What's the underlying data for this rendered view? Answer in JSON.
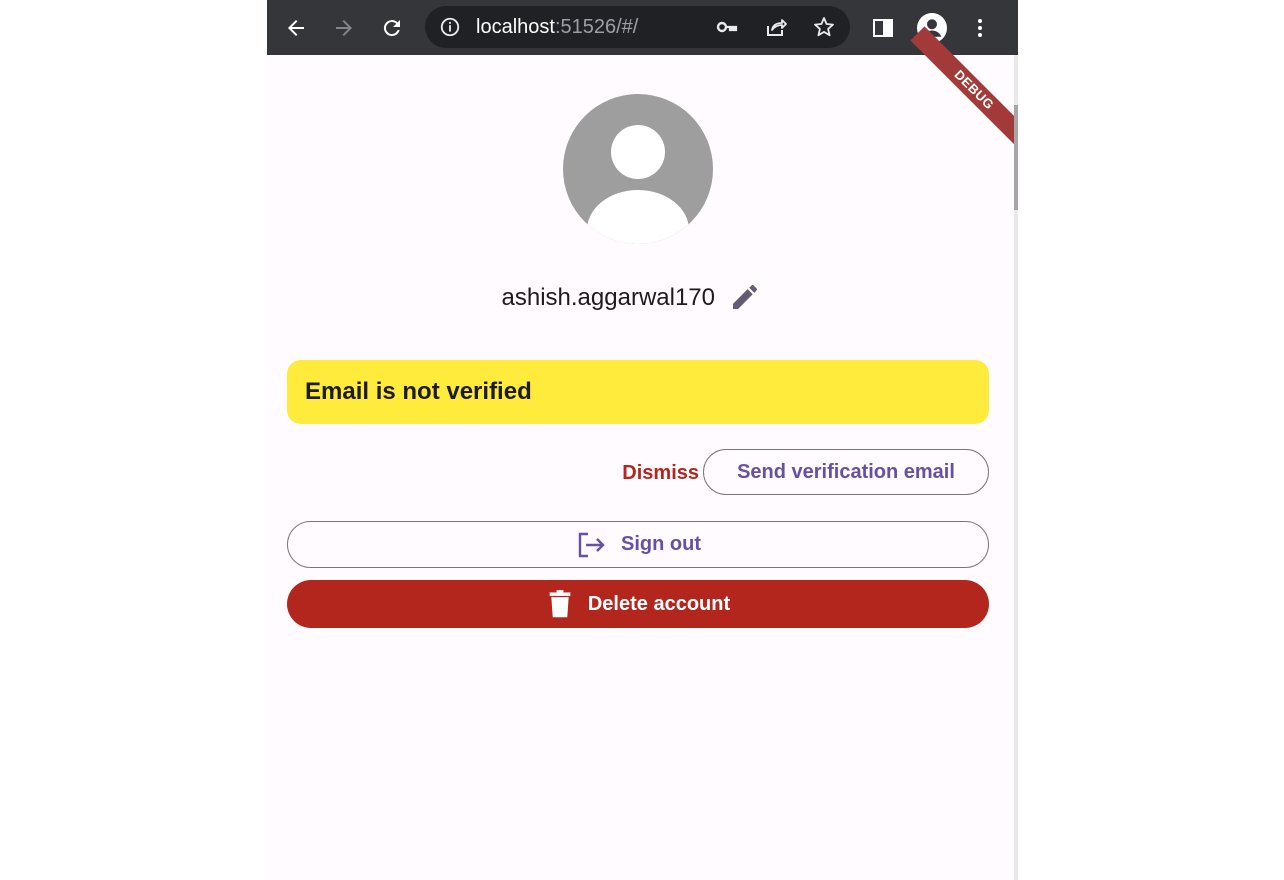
{
  "browser": {
    "url_host": "localhost",
    "url_rest": ":51526/#/",
    "icons": [
      "back-icon",
      "forward-icon",
      "reload-icon",
      "info-icon",
      "key-icon",
      "share-icon",
      "star-icon",
      "side-panel-icon",
      "profile-icon",
      "menu-icon"
    ]
  },
  "app": {
    "debug_banner": "DEBUG",
    "username": "ashish.aggarwal170",
    "banner": {
      "text": "Email is not verified",
      "color": "#ffeb3b"
    },
    "actions": {
      "dismiss_label": "Dismiss",
      "send_label": "Send verification email",
      "signout_label": "Sign out",
      "delete_label": "Delete account"
    },
    "colors": {
      "primary": "#6750a4",
      "error": "#b3261e",
      "avatar": "#9e9e9e"
    }
  }
}
